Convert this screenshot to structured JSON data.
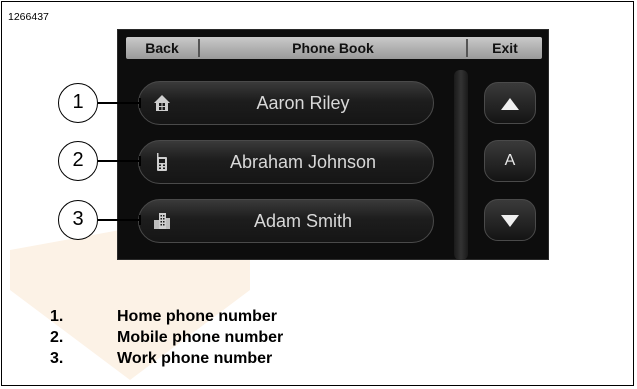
{
  "figure_id": "1266437",
  "header": {
    "back_label": "Back",
    "title": "Phone Book",
    "exit_label": "Exit"
  },
  "contacts": [
    {
      "name": "Aaron Riley",
      "icon": "home-icon"
    },
    {
      "name": "Abraham Johnson",
      "icon": "mobile-phone-icon"
    },
    {
      "name": "Adam Smith",
      "icon": "office-building-icon"
    }
  ],
  "side_buttons": {
    "up_icon": "triangle-up-icon",
    "letter": "A",
    "down_icon": "triangle-down-icon"
  },
  "callouts": [
    "1",
    "2",
    "3"
  ],
  "legend": [
    {
      "num": "1.",
      "text": "Home phone number"
    },
    {
      "num": "2.",
      "text": "Mobile phone number"
    },
    {
      "num": "3.",
      "text": "Work phone number"
    }
  ],
  "colors": {
    "screen_bg": "#0d0d0d",
    "topbar": "#b5b5b5",
    "button_text": "#d8d8d8"
  }
}
